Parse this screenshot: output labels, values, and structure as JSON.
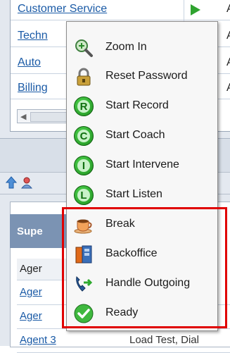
{
  "top_table": {
    "rows": [
      {
        "name": "Customer Service",
        "trailing": "A"
      },
      {
        "name": "Techn",
        "trailing": "A"
      },
      {
        "name": "Auto",
        "trailing": "A"
      },
      {
        "name": "Billing",
        "trailing": "A"
      }
    ]
  },
  "lower_panel": {
    "tab_label": "Supe",
    "column_header": "Ager",
    "rows": [
      {
        "name": "Ager",
        "extra": ""
      },
      {
        "name": "Ager",
        "extra": ""
      },
      {
        "name": "Agent 3",
        "extra": "Load Test, Dial"
      }
    ]
  },
  "context_menu": {
    "items": [
      {
        "label": "Zoom In",
        "icon": "zoom-in-icon"
      },
      {
        "label": "Reset Password",
        "icon": "lock-icon"
      },
      {
        "label": "Start Record",
        "icon": "record-icon",
        "letter": "R"
      },
      {
        "label": "Start Coach",
        "icon": "coach-icon",
        "letter": "C"
      },
      {
        "label": "Start Intervene",
        "icon": "intervene-icon",
        "letter": "I"
      },
      {
        "label": "Start Listen",
        "icon": "listen-icon",
        "letter": "L"
      },
      {
        "label": "Break",
        "icon": "coffee-cup-icon"
      },
      {
        "label": "Backoffice",
        "icon": "backoffice-icon"
      },
      {
        "label": "Handle Outgoing",
        "icon": "outgoing-call-icon"
      },
      {
        "label": "Ready",
        "icon": "ready-check-icon"
      }
    ]
  },
  "colors": {
    "highlight": "#e00000",
    "link": "#1a5aa6",
    "status_green": "#2fa32f"
  }
}
